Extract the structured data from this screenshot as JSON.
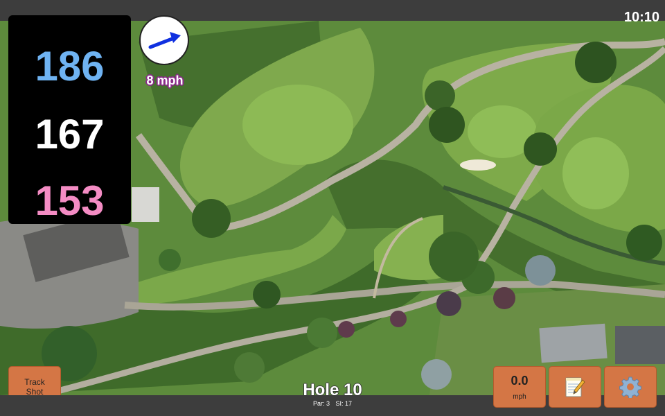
{
  "status": {
    "time": "10:10"
  },
  "yardages": {
    "back": "186",
    "middle": "167",
    "front": "153"
  },
  "colors": {
    "back": "#6fb3f2",
    "middle": "#ffffff",
    "front": "#f48cc4",
    "button": "#d47645",
    "wind_arrow": "#1030e0"
  },
  "wind": {
    "speed_label": "8 mph",
    "direction_icon": "arrow-right-up-icon"
  },
  "buttons": {
    "track_shot_line1": "Track",
    "track_shot_line2": "Shot",
    "wind_value": "0.0",
    "wind_unit": "mph",
    "notes_icon": "notepad-icon",
    "settings_icon": "gear-icon"
  },
  "hole": {
    "title": "Hole 10",
    "par": "Par: 3",
    "stroke_index": "SI: 17"
  }
}
